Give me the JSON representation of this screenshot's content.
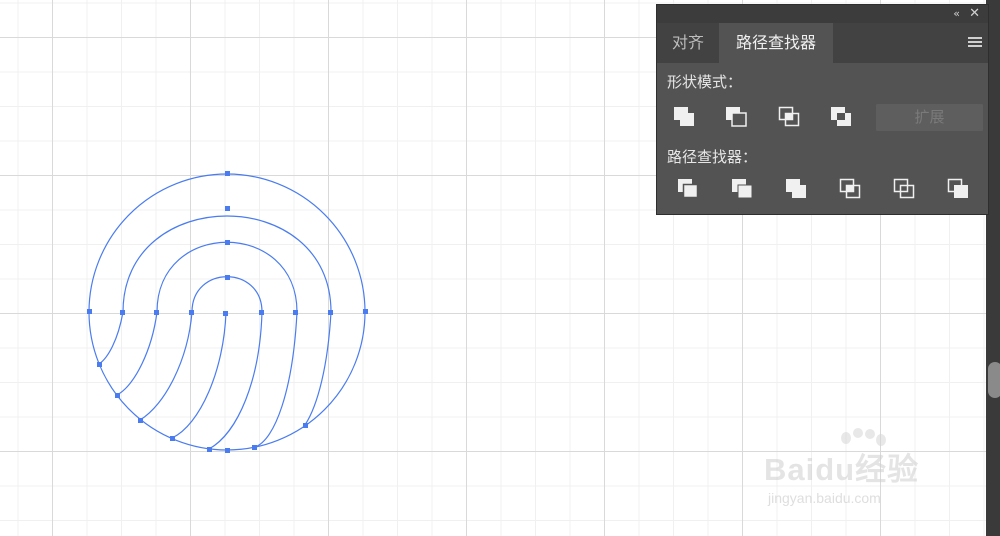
{
  "panel": {
    "collapse_glyph": "‹‹",
    "close_glyph": "✕",
    "tabs": [
      {
        "label": "对齐",
        "active": false
      },
      {
        "label": "路径查找器",
        "active": true
      }
    ],
    "menu_icon": "hamburger-menu-icon",
    "shape_modes_label": "形状模式：",
    "shape_modes": [
      {
        "name": "unite-icon"
      },
      {
        "name": "minus-front-icon"
      },
      {
        "name": "intersect-icon"
      },
      {
        "name": "exclude-icon"
      }
    ],
    "expand_label": "扩展",
    "pathfinders_label": "路径查找器：",
    "pathfinders": [
      {
        "name": "divide-icon"
      },
      {
        "name": "trim-icon"
      },
      {
        "name": "merge-icon"
      },
      {
        "name": "crop-icon"
      },
      {
        "name": "outline-icon"
      },
      {
        "name": "minus-back-icon"
      }
    ]
  },
  "watermark": {
    "brand": "Baidu经验",
    "url": "jingyan.baidu.com"
  },
  "colors": {
    "path_stroke": "#4a7cf0",
    "panel_bg": "#535353",
    "tab_bar_bg": "#424242"
  }
}
